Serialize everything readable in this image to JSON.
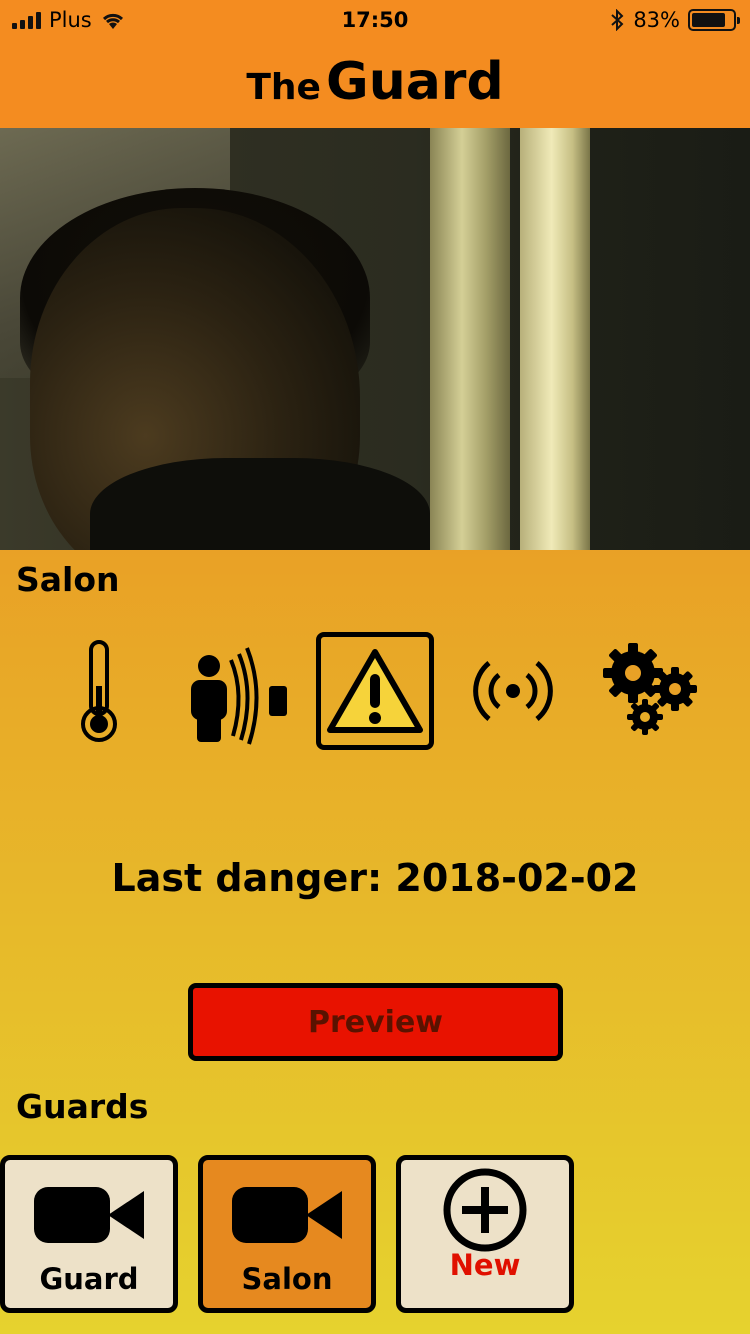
{
  "status_bar": {
    "carrier": "Plus",
    "time": "17:50",
    "battery_percent": "83%",
    "battery_level": 0.83
  },
  "nav": {
    "title_small": "The",
    "title_big": "Guard"
  },
  "camera": {
    "name": "Salon"
  },
  "icons": [
    {
      "name": "thermometer-icon"
    },
    {
      "name": "motion-sensor-icon"
    },
    {
      "name": "warning-icon",
      "selected": true
    },
    {
      "name": "broadcast-icon"
    },
    {
      "name": "settings-gears-icon"
    }
  ],
  "danger": {
    "text": "Last danger: 2018-02-02"
  },
  "actions": {
    "preview_label": "Preview"
  },
  "guards": {
    "title": "Guards",
    "items": [
      {
        "label": "Guard",
        "icon": "video-camera-icon",
        "bg": "#ede1c8",
        "label_color": "#000000"
      },
      {
        "label": "Salon",
        "icon": "video-camera-icon",
        "bg": "#e6891f",
        "label_color": "#000000"
      },
      {
        "label": "New",
        "icon": "plus-circle-icon",
        "bg": "#ede1c8",
        "label_color": "#e01000"
      }
    ]
  },
  "colors": {
    "nav_bg": "#f48c20",
    "preview_bg": "#e81200",
    "warning_yellow": "#f6d33a"
  }
}
